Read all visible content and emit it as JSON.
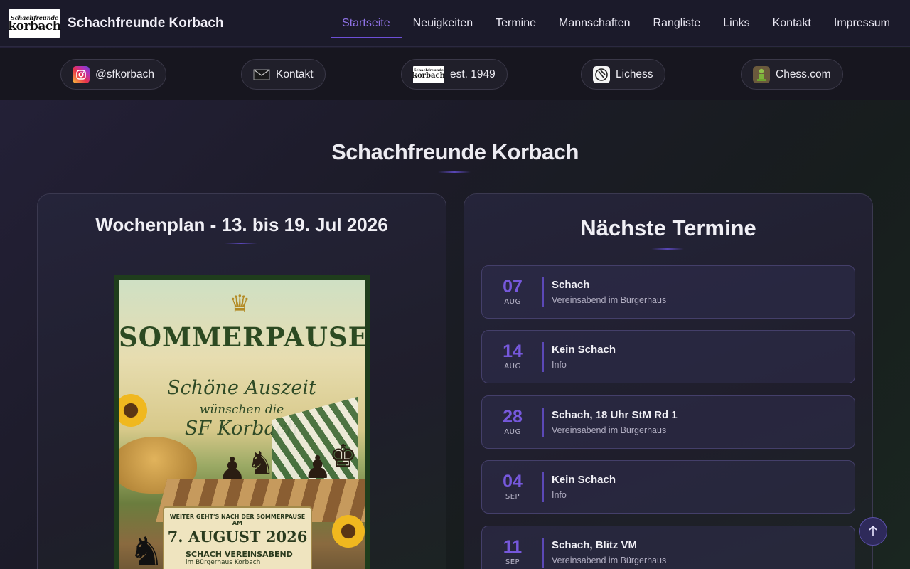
{
  "brand": {
    "logo_line1": "Schachfreunde",
    "logo_line2": "korbach",
    "title": "Schachfreunde Korbach"
  },
  "nav": {
    "items": [
      {
        "label": "Startseite",
        "active": true
      },
      {
        "label": "Neuigkeiten"
      },
      {
        "label": "Termine"
      },
      {
        "label": "Mannschaften"
      },
      {
        "label": "Rangliste"
      },
      {
        "label": "Links"
      },
      {
        "label": "Kontakt"
      },
      {
        "label": "Impressum"
      }
    ]
  },
  "links": {
    "instagram": "@sfkorbach",
    "contact": "Kontakt",
    "established": "est. 1949",
    "lichess": "Lichess",
    "chesscom": "Chess.com"
  },
  "page": {
    "title": "Schachfreunde Korbach"
  },
  "weekplan": {
    "title": "Wochenplan - 13. bis 19. Jul 2026",
    "poster": {
      "headline": "SOMMERPAUSE",
      "line1": "Schöne Auszeit",
      "line2": "wünschen die",
      "line3": "SF Korbach",
      "banner_line1": "WEITER GEHT'S NACH DER SOMMERPAUSE",
      "banner_line2": "AM",
      "banner_date": "7. AUGUST 2026",
      "banner_event": "SCHACH VEREINSABEND",
      "banner_place": "im Bürgerhaus Korbach"
    }
  },
  "events": {
    "title": "Nächste Termine",
    "items": [
      {
        "day": "07",
        "month": "AUG",
        "title": "Schach",
        "sub": "Vereinsabend im Bürgerhaus"
      },
      {
        "day": "14",
        "month": "AUG",
        "title": "Kein Schach",
        "sub": "Info"
      },
      {
        "day": "28",
        "month": "AUG",
        "title": "Schach, 18 Uhr StM Rd 1",
        "sub": "Vereinsabend im Bürgerhaus"
      },
      {
        "day": "04",
        "month": "SEP",
        "title": "Kein Schach",
        "sub": "Info"
      },
      {
        "day": "11",
        "month": "SEP",
        "title": "Schach, Blitz VM",
        "sub": "Vereinsabend im Bürgerhaus"
      }
    ]
  },
  "icons": {
    "scroll_top": "arrow-up-icon"
  },
  "colors": {
    "accent": "#7658dc",
    "nav_active": "#8f72e6"
  }
}
